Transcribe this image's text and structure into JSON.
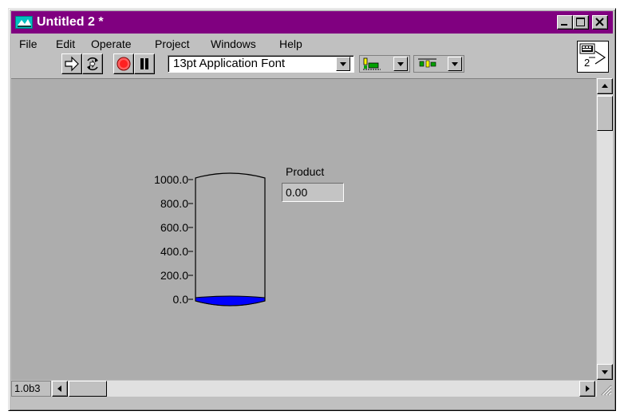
{
  "window": {
    "title": "Untitled 2 *"
  },
  "menu": {
    "items": [
      {
        "label": "File"
      },
      {
        "label": "Edit"
      },
      {
        "label": "Operate"
      },
      {
        "label": "Project"
      },
      {
        "label": "Windows"
      },
      {
        "label": "Help"
      }
    ]
  },
  "toolbar": {
    "font_selector_value": "13pt Application Font"
  },
  "vi_icon": {
    "label": "2"
  },
  "front_panel": {
    "tank": {
      "scale_ticks": [
        "1000.0",
        "800.0",
        "600.0",
        "400.0",
        "200.0",
        "0.0"
      ],
      "scale_min": 0,
      "scale_max": 1000,
      "fill_color": "#0000ff",
      "level": 0
    },
    "indicator": {
      "label": "Product",
      "value": "0.00"
    }
  },
  "status": {
    "version": "1.0b3"
  },
  "colors": {
    "title_bar": "#800080",
    "panel_bg": "#adadad",
    "tank_fill": "#0000ff"
  }
}
